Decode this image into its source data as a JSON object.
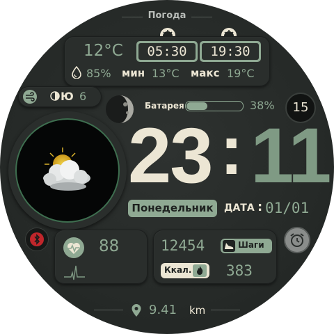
{
  "colors": {
    "accent": "#8fa993",
    "digits_hour": "#ece6d4",
    "digits_minute": "#7f9a84",
    "background": "#262a28",
    "alert_red": "#c0262b"
  },
  "weather": {
    "title": "Погода",
    "temperature": "12°C",
    "sunrise": "05:30",
    "sunset": "19:30",
    "humidity": "85%",
    "min_label": "мин",
    "min_value": "13°C",
    "max_label": "макс",
    "max_value": "19°C",
    "icon": "cloudy-sun-icon"
  },
  "wind": {
    "direction": "Ю",
    "speed": "6",
    "icon": "wind-icon"
  },
  "moon": {
    "icon": "moon-phase-icon"
  },
  "battery": {
    "label": "Батарея",
    "value": "38%",
    "level": 0.38
  },
  "notification_count": "15",
  "time": {
    "hours": "23",
    "separator": ":",
    "minutes": "11"
  },
  "date": {
    "weekday": "Понедельник",
    "label": "ДАТА",
    "separator": ":",
    "value": "01/01"
  },
  "heart": {
    "value": "88",
    "icon": "heart-icon"
  },
  "steps": {
    "value": "12454",
    "label": "Шаги",
    "icon": "shoe-icon"
  },
  "calories": {
    "label": "Ккал.",
    "value": "383",
    "icon": "flame-icon"
  },
  "distance": {
    "value": "9.41",
    "unit": "km",
    "icon": "location-pin-icon"
  },
  "complications": {
    "left_icon": "bluetooth-icon",
    "right_icon": "alarm-clock-icon"
  }
}
